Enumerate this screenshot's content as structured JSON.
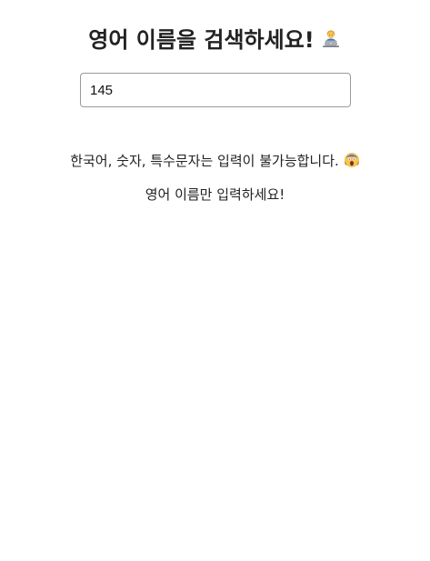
{
  "header": {
    "title": "영어 이름을 검색하세요!",
    "title_icon": "person-with-laptop-icon"
  },
  "search": {
    "value": "145",
    "placeholder": ""
  },
  "messages": {
    "error_line": "한국어, 숫자, 특수문자는 입력이 불가능합니다.",
    "error_icon": "screaming-face-icon",
    "hint_line": "영어 이름만 입력하세요!"
  },
  "colors": {
    "text": "#222222",
    "input_border": "#9a9a9a",
    "background": "#ffffff"
  }
}
